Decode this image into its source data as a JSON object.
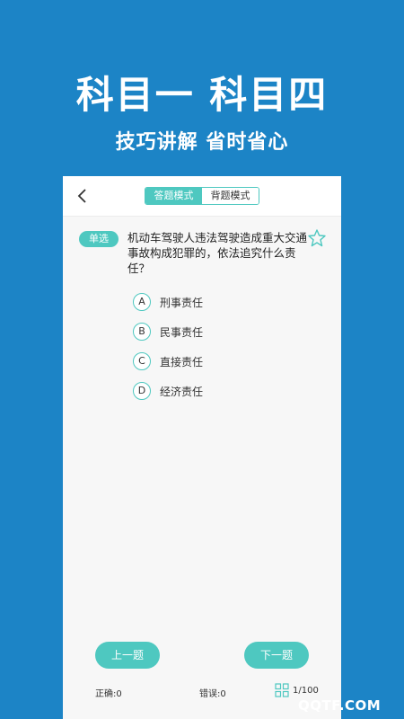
{
  "hero": {
    "title": "科目一 科目四",
    "subtitle": "技巧讲解 省时省心"
  },
  "topbar": {
    "back_icon": "chevron-left-icon",
    "modes": [
      {
        "label": "答题模式",
        "active": true
      },
      {
        "label": "背题模式",
        "active": false
      }
    ]
  },
  "question": {
    "type_badge": "单选",
    "text": "机动车驾驶人违法驾驶造成重大交通事故构成犯罪的，依法追究什么责任？",
    "favorite_icon": "star-icon",
    "options": [
      {
        "letter": "A",
        "text": "刑事责任"
      },
      {
        "letter": "B",
        "text": "民事责任"
      },
      {
        "letter": "C",
        "text": "直接责任"
      },
      {
        "letter": "D",
        "text": "经济责任"
      }
    ]
  },
  "footer": {
    "prev_label": "上一题",
    "next_label": "下一题",
    "correct": "正确:0",
    "wrong": "错误:0",
    "progress": "1/100",
    "grid_icon": "grid-icon"
  },
  "watermark": "QQTF.COM",
  "colors": {
    "background": "#1c84c6",
    "accent": "#4ec8c0"
  }
}
